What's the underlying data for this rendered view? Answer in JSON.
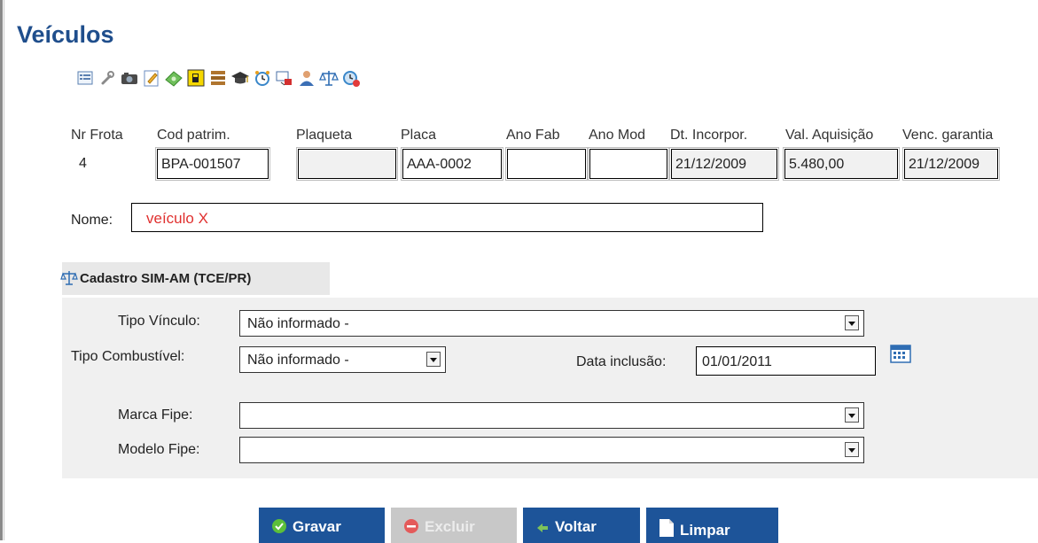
{
  "page": {
    "title": "Veículos"
  },
  "toolbar": {
    "icons": [
      "list-icon",
      "wrench-icon",
      "camera-icon",
      "edit-icon",
      "money-icon",
      "fuel-icon",
      "documents-icon",
      "graduation-cap-icon",
      "alarm-clock-icon",
      "transfer-icon",
      "user-icon",
      "balance-scale-icon",
      "schedule-icon"
    ]
  },
  "vehicle": {
    "columns": {
      "nr_frota": "Nr Frota",
      "cod_patrim": "Cod patrim.",
      "plaqueta": "Plaqueta",
      "placa": "Placa",
      "ano_fab": "Ano Fab",
      "ano_mod": "Ano Mod",
      "dt_incorpor": "Dt. Incorpor.",
      "val_aquisicao": "Val. Aquisição",
      "venc_garantia": "Venc. garantia"
    },
    "values": {
      "nr_frota": "4",
      "cod_patrim": "BPA-001507",
      "plaqueta": "",
      "placa": "AAA-0002",
      "ano_fab": "",
      "ano_mod": "",
      "dt_incorpor": "21/12/2009",
      "val_aquisicao": "5.480,00",
      "venc_garantia": "21/12/2009"
    },
    "nome_label": "Nome:",
    "nome_value": "veículo X"
  },
  "sim_am": {
    "section_title": "Cadastro SIM-AM (TCE/PR)",
    "tipo_vinculo_label": "Tipo Vínculo:",
    "tipo_vinculo_value": "Não informado -",
    "tipo_combustivel_label": "Tipo Combustível:",
    "tipo_combustivel_value": "Não informado -",
    "data_inclusao_label": "Data inclusão:",
    "data_inclusao_value": "01/01/2011",
    "marca_fipe_label": "Marca Fipe:",
    "marca_fipe_value": "",
    "modelo_fipe_label": "Modelo Fipe:",
    "modelo_fipe_value": ""
  },
  "buttons": {
    "gravar": "Gravar",
    "excluir": "Excluir",
    "voltar": "Voltar",
    "limpar": "Limpar"
  },
  "colors": {
    "title": "#1f4e8c",
    "button_primary": "#1d5499",
    "button_disabled": "#c8c8c8",
    "nome_text": "#e0302f",
    "panel_bg": "#f0f0f0"
  }
}
